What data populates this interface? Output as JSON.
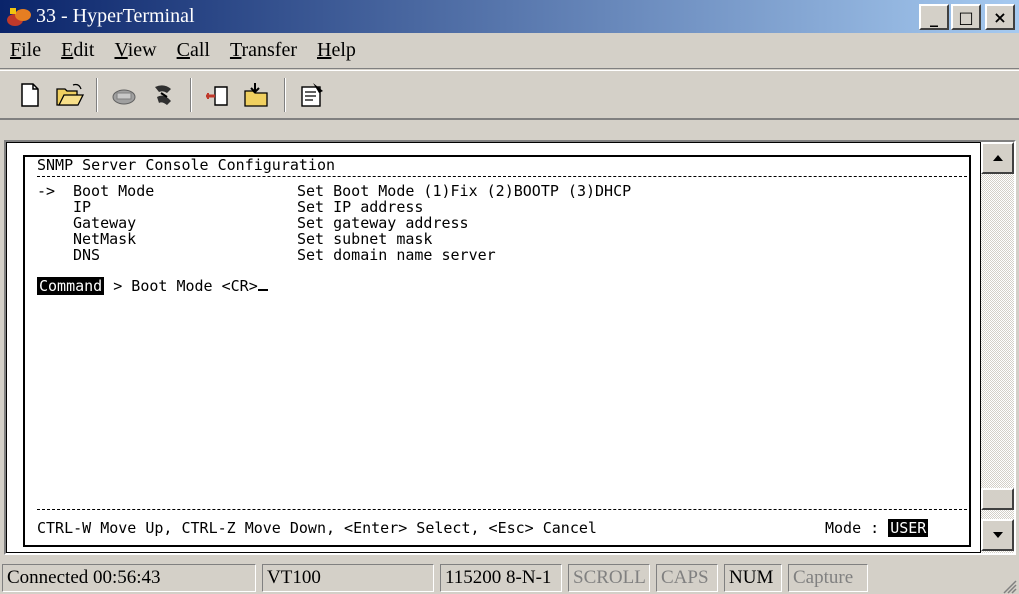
{
  "window": {
    "title": "33 - HyperTerminal",
    "minimize_label": "_",
    "maximize_label": "□",
    "close_label": "×"
  },
  "menu": {
    "items": [
      {
        "u": "F",
        "rest": "ile"
      },
      {
        "u": "E",
        "rest": "dit"
      },
      {
        "u": "V",
        "rest": "iew"
      },
      {
        "u": "C",
        "rest": "all"
      },
      {
        "u": "T",
        "rest": "ransfer"
      },
      {
        "u": "H",
        "rest": "elp"
      }
    ]
  },
  "toolbar": {
    "icons": [
      "new-icon",
      "open-icon",
      "connect-icon",
      "disconnect-icon",
      "send-icon",
      "receive-icon",
      "properties-icon"
    ]
  },
  "terminal": {
    "header": "SNMP Server Console Configuration",
    "rows": [
      {
        "arrow": "->",
        "name": "Boot Mode",
        "desc": "Set Boot Mode (1)Fix (2)BOOTP (3)DHCP"
      },
      {
        "arrow": "",
        "name": "IP",
        "desc": "Set IP address"
      },
      {
        "arrow": "",
        "name": "Gateway",
        "desc": "Set gateway address"
      },
      {
        "arrow": "",
        "name": "NetMask",
        "desc": "Set subnet mask"
      },
      {
        "arrow": "",
        "name": "DNS",
        "desc": "Set domain name server"
      }
    ],
    "command_label": "Command",
    "command_text": " > Boot Mode <CR>",
    "footer_help": "CTRL-W Move Up, CTRL-Z Move Down, <Enter> Select, <Esc> Cancel",
    "mode_label": "Mode : ",
    "mode_value": "USER"
  },
  "status": {
    "connected": "Connected 00:56:43",
    "emulation": "VT100",
    "settings": "115200 8-N-1",
    "scroll": "SCROLL",
    "caps": "CAPS",
    "num": "NUM",
    "capture": "Capture"
  }
}
